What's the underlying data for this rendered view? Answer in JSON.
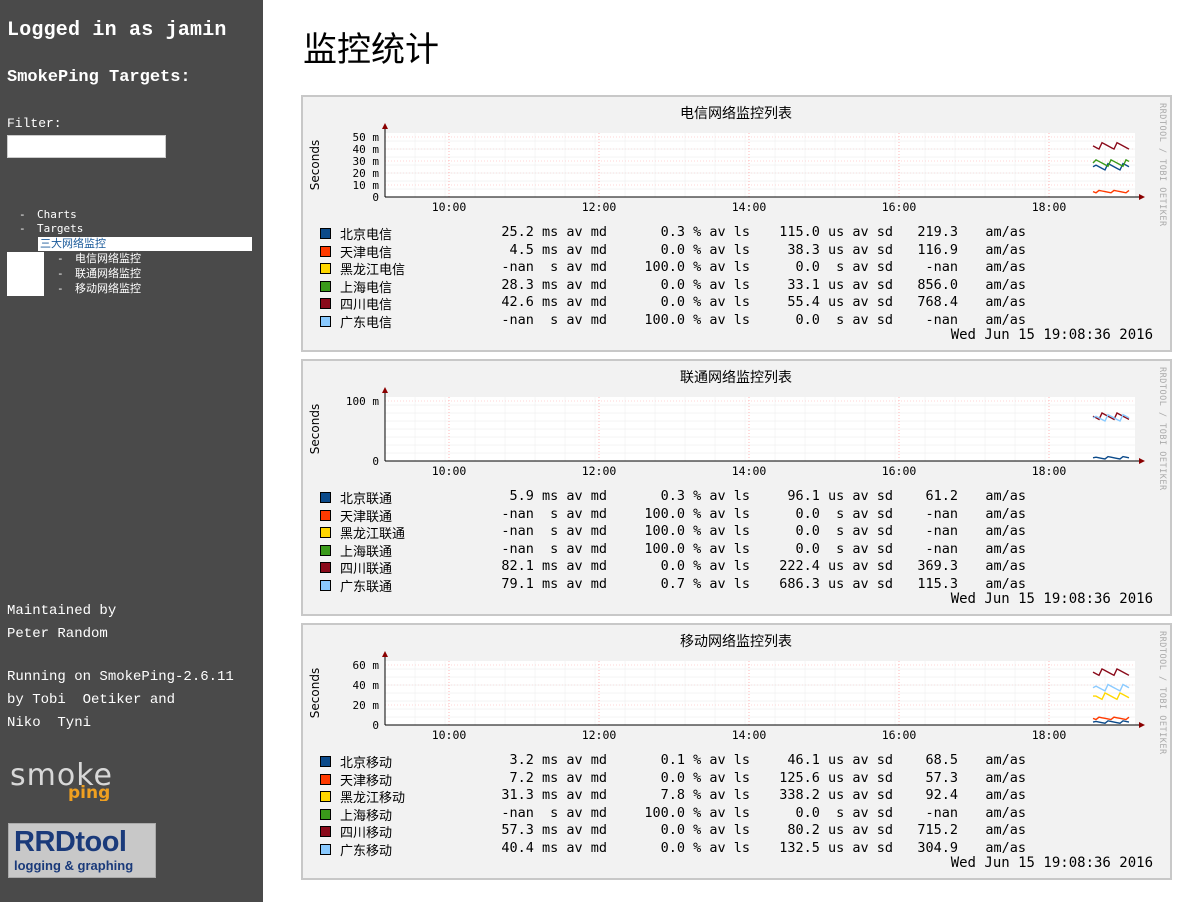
{
  "sidebar": {
    "logged_in": "Logged in as jamin",
    "targets_heading": "SmokePing Targets:",
    "filter_label": "Filter:",
    "filter_value": "",
    "nav": [
      {
        "label": "Charts",
        "dash": "-"
      },
      {
        "label": "Targets",
        "dash": "-"
      },
      {
        "label": "三大网络监控",
        "selected": true
      },
      {
        "label": "电信网络监控",
        "dash": "-"
      },
      {
        "label": "联通网络监控",
        "dash": "-"
      },
      {
        "label": "移动网络监控",
        "dash": "-"
      }
    ],
    "maintained": "Maintained by\nPeter Random",
    "running": "Running on SmokePing-2.6.11\nby Tobi  Oetiker and\nNiko  Tyni",
    "logo_smoke": "smoke",
    "logo_ping": "ping",
    "logo_rrd": "RRDtool",
    "logo_rrd_sub": "logging & graphing"
  },
  "page_title": "监控统计",
  "graphs": [
    {
      "title": "电信网络监控列表",
      "ylabel": "Seconds",
      "side_label": "RRDTOOL / TOBI OETIKER",
      "timestamp": "Wed Jun 15 19:08:36 2016",
      "y_ticks": [
        "50 m",
        "40 m",
        "30 m",
        "20 m",
        "10 m",
        "0"
      ],
      "x_ticks": [
        "10:00",
        "12:00",
        "14:00",
        "16:00",
        "18:00"
      ],
      "rows": [
        {
          "name": "北京电信",
          "med": "25.2 ms av md",
          "ls": "0.3 % av ls",
          "sd": "115.0 us av sd",
          "amas": "219.3",
          "unit": "am/as",
          "color": "#0b4a8a"
        },
        {
          "name": "天津电信",
          "med": "4.5 ms av md",
          "ls": "0.0 % av ls",
          "sd": "38.3 us av sd",
          "amas": "116.9",
          "unit": "am/as",
          "color": "#ff3a00"
        },
        {
          "name": "黑龙江电信",
          "med": "-nan  s av md",
          "ls": "100.0 % av ls",
          "sd": "0.0  s av sd",
          "amas": "-nan",
          "unit": "am/as",
          "color": "#ffd700"
        },
        {
          "name": "上海电信",
          "med": "28.3 ms av md",
          "ls": "0.0 % av ls",
          "sd": "33.1 us av sd",
          "amas": "856.0",
          "unit": "am/as",
          "color": "#3a9a1a"
        },
        {
          "name": "四川电信",
          "med": "42.6 ms av md",
          "ls": "0.0 % av ls",
          "sd": "55.4 us av sd",
          "amas": "768.4",
          "unit": "am/as",
          "color": "#8a0a1a"
        },
        {
          "name": "广东电信",
          "med": "-nan  s av md",
          "ls": "100.0 % av ls",
          "sd": "0.0  s av sd",
          "amas": "-nan",
          "unit": "am/as",
          "color": "#8acaff"
        }
      ]
    },
    {
      "title": "联通网络监控列表",
      "ylabel": "Seconds",
      "side_label": "RRDTOOL / TOBI OETIKER",
      "timestamp": "Wed Jun 15 19:08:36 2016",
      "y_ticks": [
        "100 m",
        "0"
      ],
      "x_ticks": [
        "10:00",
        "12:00",
        "14:00",
        "16:00",
        "18:00"
      ],
      "rows": [
        {
          "name": "北京联通",
          "med": "5.9 ms av md",
          "ls": "0.3 % av ls",
          "sd": "96.1 us av sd",
          "amas": "61.2",
          "unit": "am/as",
          "color": "#0b4a8a"
        },
        {
          "name": "天津联通",
          "med": "-nan  s av md",
          "ls": "100.0 % av ls",
          "sd": "0.0  s av sd",
          "amas": "-nan",
          "unit": "am/as",
          "color": "#ff3a00"
        },
        {
          "name": "黑龙江联通",
          "med": "-nan  s av md",
          "ls": "100.0 % av ls",
          "sd": "0.0  s av sd",
          "amas": "-nan",
          "unit": "am/as",
          "color": "#ffd700"
        },
        {
          "name": "上海联通",
          "med": "-nan  s av md",
          "ls": "100.0 % av ls",
          "sd": "0.0  s av sd",
          "amas": "-nan",
          "unit": "am/as",
          "color": "#3a9a1a"
        },
        {
          "name": "四川联通",
          "med": "82.1 ms av md",
          "ls": "0.0 % av ls",
          "sd": "222.4 us av sd",
          "amas": "369.3",
          "unit": "am/as",
          "color": "#8a0a1a"
        },
        {
          "name": "广东联通",
          "med": "79.1 ms av md",
          "ls": "0.7 % av ls",
          "sd": "686.3 us av sd",
          "amas": "115.3",
          "unit": "am/as",
          "color": "#8acaff"
        }
      ]
    },
    {
      "title": "移动网络监控列表",
      "ylabel": "Seconds",
      "side_label": "RRDTOOL / TOBI OETIKER",
      "timestamp": "Wed Jun 15 19:08:36 2016",
      "y_ticks": [
        "60 m",
        "40 m",
        "20 m",
        "0"
      ],
      "x_ticks": [
        "10:00",
        "12:00",
        "14:00",
        "16:00",
        "18:00"
      ],
      "rows": [
        {
          "name": "北京移动",
          "med": "3.2 ms av md",
          "ls": "0.1 % av ls",
          "sd": "46.1 us av sd",
          "amas": "68.5",
          "unit": "am/as",
          "color": "#0b4a8a"
        },
        {
          "name": "天津移动",
          "med": "7.2 ms av md",
          "ls": "0.0 % av ls",
          "sd": "125.6 us av sd",
          "amas": "57.3",
          "unit": "am/as",
          "color": "#ff3a00"
        },
        {
          "name": "黑龙江移动",
          "med": "31.3 ms av md",
          "ls": "7.8 % av ls",
          "sd": "338.2 us av sd",
          "amas": "92.4",
          "unit": "am/as",
          "color": "#ffd700"
        },
        {
          "name": "上海移动",
          "med": "-nan  s av md",
          "ls": "100.0 % av ls",
          "sd": "0.0  s av sd",
          "amas": "-nan",
          "unit": "am/as",
          "color": "#3a9a1a"
        },
        {
          "name": "四川移动",
          "med": "57.3 ms av md",
          "ls": "0.0 % av ls",
          "sd": "80.2 us av sd",
          "amas": "715.2",
          "unit": "am/as",
          "color": "#8a0a1a"
        },
        {
          "name": "广东移动",
          "med": "40.4 ms av md",
          "ls": "0.0 % av ls",
          "sd": "132.5 us av sd",
          "amas": "304.9",
          "unit": "am/as",
          "color": "#8acaff"
        }
      ]
    }
  ]
}
